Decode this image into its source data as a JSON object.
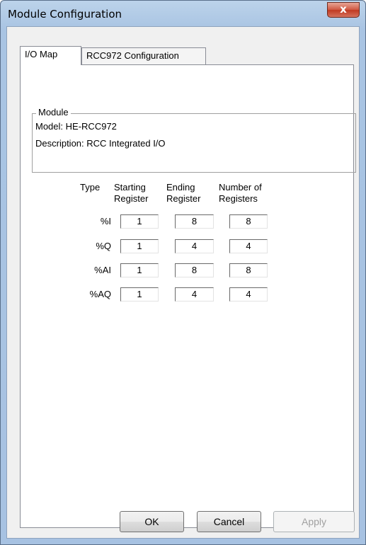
{
  "window": {
    "title": "Module Configuration",
    "close_glyph": "x"
  },
  "tabs": [
    {
      "label": "I/O Map",
      "active": true
    },
    {
      "label": "RCC972 Configuration",
      "active": false
    }
  ],
  "module": {
    "legend": "Module",
    "model_label": "Model:",
    "model_value": "HE-RCC972",
    "description_label": "Description:",
    "description_value": "RCC Integrated I/O"
  },
  "table": {
    "headers": {
      "type": "Type",
      "starting": [
        "Starting",
        "Register"
      ],
      "ending": [
        "Ending",
        "Register"
      ],
      "number": [
        "Number of",
        "Registers"
      ]
    },
    "rows": [
      {
        "type": "%I",
        "start": "1",
        "end": "8",
        "count": "8"
      },
      {
        "type": "%Q",
        "start": "1",
        "end": "4",
        "count": "4"
      },
      {
        "type": "%AI",
        "start": "1",
        "end": "8",
        "count": "8"
      },
      {
        "type": "%AQ",
        "start": "1",
        "end": "4",
        "count": "4"
      }
    ]
  },
  "buttons": {
    "ok": "OK",
    "cancel": "Cancel",
    "apply": "Apply"
  }
}
